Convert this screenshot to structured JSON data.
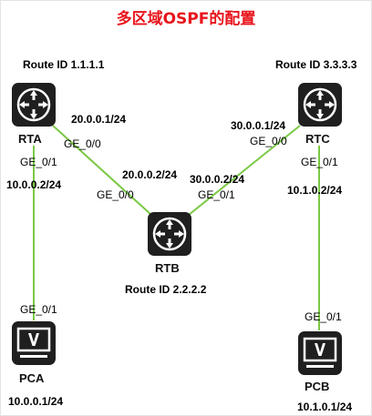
{
  "title": "多区域OSPF的配置",
  "colors": {
    "link": "#7ac943",
    "title": "#e8141b",
    "device": "#1f1f1f"
  },
  "devices": {
    "rta": {
      "name": "RTA",
      "route_id": "Route ID 1.1.1.1",
      "icon": "router-icon"
    },
    "rtb": {
      "name": "RTB",
      "route_id": "Route ID 2.2.2.2",
      "icon": "router-icon"
    },
    "rtc": {
      "name": "RTC",
      "route_id": "Route ID 3.3.3.3",
      "icon": "router-icon"
    },
    "pca": {
      "name": "PCA",
      "ip": "10.0.0.1/24",
      "icon": "pc-monitor-icon"
    },
    "pcb": {
      "name": "PCB",
      "ip": "10.1.0.1/24",
      "icon": "pc-monitor-icon"
    }
  },
  "links": {
    "rta_rtb": {
      "rta_port": "GE_0/0",
      "rta_ip": "20.0.0.1/24",
      "rtb_port": "GE_0/0",
      "rtb_ip": "20.0.0.2/24"
    },
    "rtc_rtb": {
      "rtc_port": "GE_0/0",
      "rtc_ip": "30.0.0.1/24",
      "rtb_port": "GE_0/1",
      "rtb_ip": "30.0.0.2/24"
    },
    "rta_pca": {
      "rta_port": "GE_0/1",
      "rta_ip": "10.0.0.2/24",
      "pca_port": "GE_0/1"
    },
    "rtc_pcb": {
      "rtc_port": "GE_0/1",
      "rtc_ip": "10.1.0.2/24",
      "pcb_port": "GE_0/1"
    }
  }
}
